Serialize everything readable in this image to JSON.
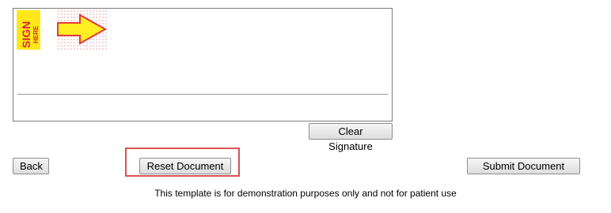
{
  "signature_pad": {
    "badge_word_1": "SIGN",
    "badge_word_2": "HERE"
  },
  "buttons": {
    "clear_signature": "Clear Signature",
    "back": "Back",
    "reset_document": "Reset Document",
    "submit_document": "Submit Document"
  },
  "footer": {
    "disclaimer": "This template is for demonstration purposes only and not for patient use"
  },
  "colors": {
    "badge_yellow": "#ffe81a",
    "badge_text": "#d9282f",
    "highlight_border": "#d9534f"
  }
}
